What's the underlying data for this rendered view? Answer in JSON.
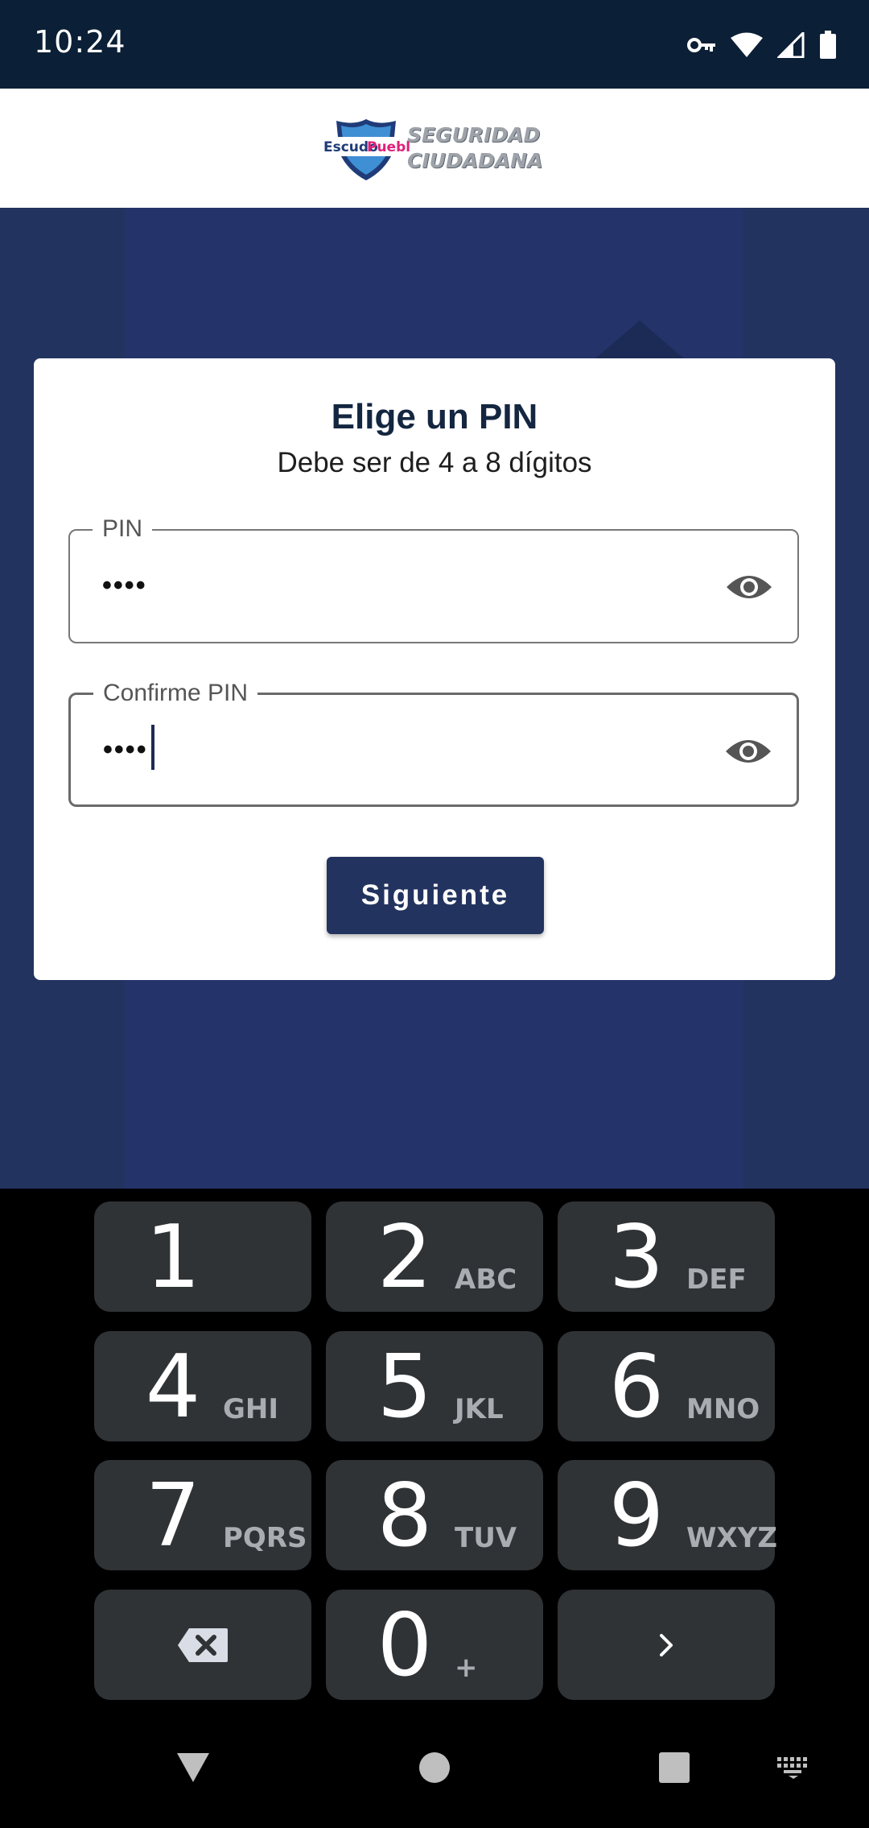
{
  "status_bar": {
    "time": "10:24",
    "icons": [
      "vpn-key-icon",
      "wifi-icon",
      "signal-icon",
      "battery-icon"
    ]
  },
  "header": {
    "logo_brand_left": "Escudo",
    "logo_brand_right": "Puebla",
    "logo_text_line1": "SEGURIDAD",
    "logo_text_line2": "CIUDADANA"
  },
  "card": {
    "title": "Elige un PIN",
    "subtitle": "Debe ser de 4 a 8 dígitos",
    "pin_field": {
      "label": "PIN",
      "value": "••••"
    },
    "confirm_field": {
      "label": "Confirme PIN",
      "value": "••••"
    },
    "next_button": "Siguiente"
  },
  "keypad": {
    "keys": [
      {
        "digit": "1",
        "letters": ""
      },
      {
        "digit": "2",
        "letters": "ABC"
      },
      {
        "digit": "3",
        "letters": "DEF"
      },
      {
        "digit": "4",
        "letters": "GHI"
      },
      {
        "digit": "5",
        "letters": "JKL"
      },
      {
        "digit": "6",
        "letters": "MNO"
      },
      {
        "digit": "7",
        "letters": "PQRS"
      },
      {
        "digit": "8",
        "letters": "TUV"
      },
      {
        "digit": "9",
        "letters": "WXYZ"
      },
      {
        "digit": "0",
        "letters": "+"
      }
    ],
    "special_keys": [
      "backspace-icon",
      "next-arrow-icon"
    ]
  },
  "nav_bar": {
    "buttons": [
      "back-triangle-icon",
      "home-circle-icon",
      "recents-square-icon",
      "keyboard-icon"
    ]
  },
  "colors": {
    "status_bar_bg": "#0b1f37",
    "primary_blue": "#23335f",
    "key_bg": "#2f3336"
  }
}
